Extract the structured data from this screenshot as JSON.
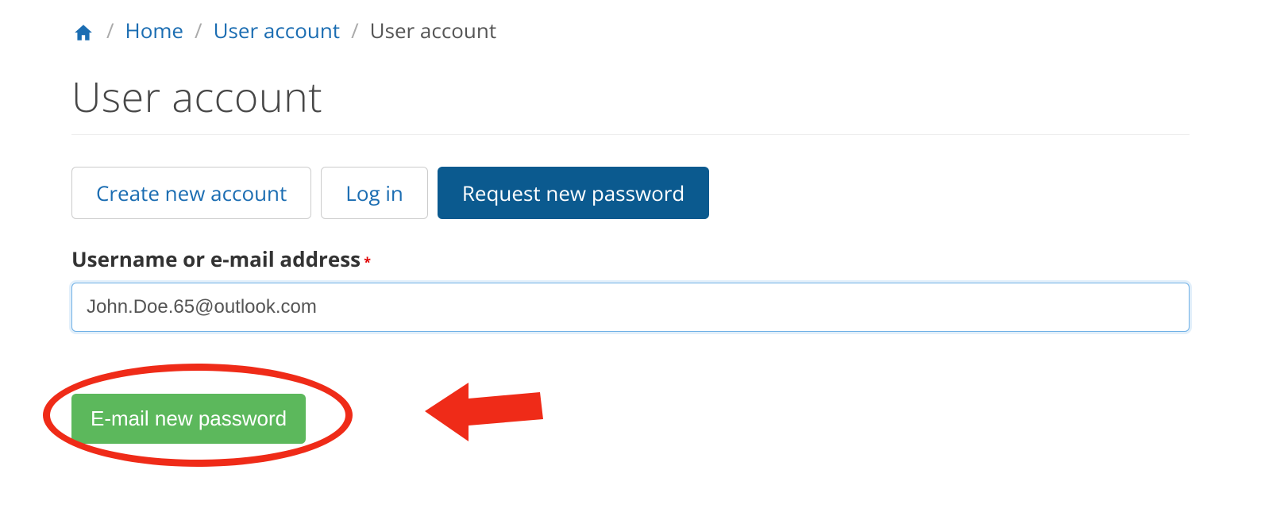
{
  "breadcrumb": {
    "home_label": "Home",
    "user_account_link": "User account",
    "current": "User account"
  },
  "page": {
    "title": "User account"
  },
  "tabs": {
    "create": "Create new account",
    "login": "Log in",
    "request": "Request new password"
  },
  "form": {
    "label": "Username or e-mail address",
    "required_marker": "*",
    "value": "John.Doe.65@outlook.com",
    "submit_label": "E-mail new password"
  }
}
